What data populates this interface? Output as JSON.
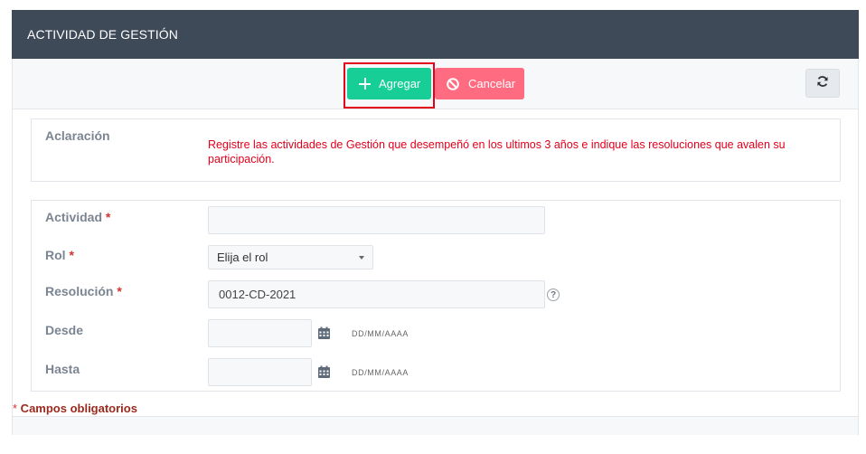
{
  "header": {
    "title": "ACTIVIDAD DE GESTIÓN"
  },
  "toolbar": {
    "add_label": "Agregar",
    "cancel_label": "Cancelar",
    "add_color": "#17cf96",
    "cancel_color": "#ff6b81",
    "refresh_icon": "refresh-icon"
  },
  "note": {
    "label": "Aclaración",
    "text": "Registre las actividades de Gestión que desempeñó en los ultimos 3 años e indique las resoluciones que avalen su participación."
  },
  "form": {
    "actividad": {
      "label": "Actividad",
      "required": "*",
      "value": ""
    },
    "rol": {
      "label": "Rol",
      "required": "*",
      "selected": "Elija el rol"
    },
    "resolucion": {
      "label": "Resolución",
      "required": "*",
      "value": "0012-CD-2021",
      "help": "?"
    },
    "desde": {
      "label": "Desde",
      "value": "",
      "hint": "DD/MM/AAAA"
    },
    "hasta": {
      "label": "Hasta",
      "value": "",
      "hint": "DD/MM/AAAA"
    }
  },
  "footer": {
    "required_mark": "*",
    "required_text": " Campos obligatorios"
  }
}
